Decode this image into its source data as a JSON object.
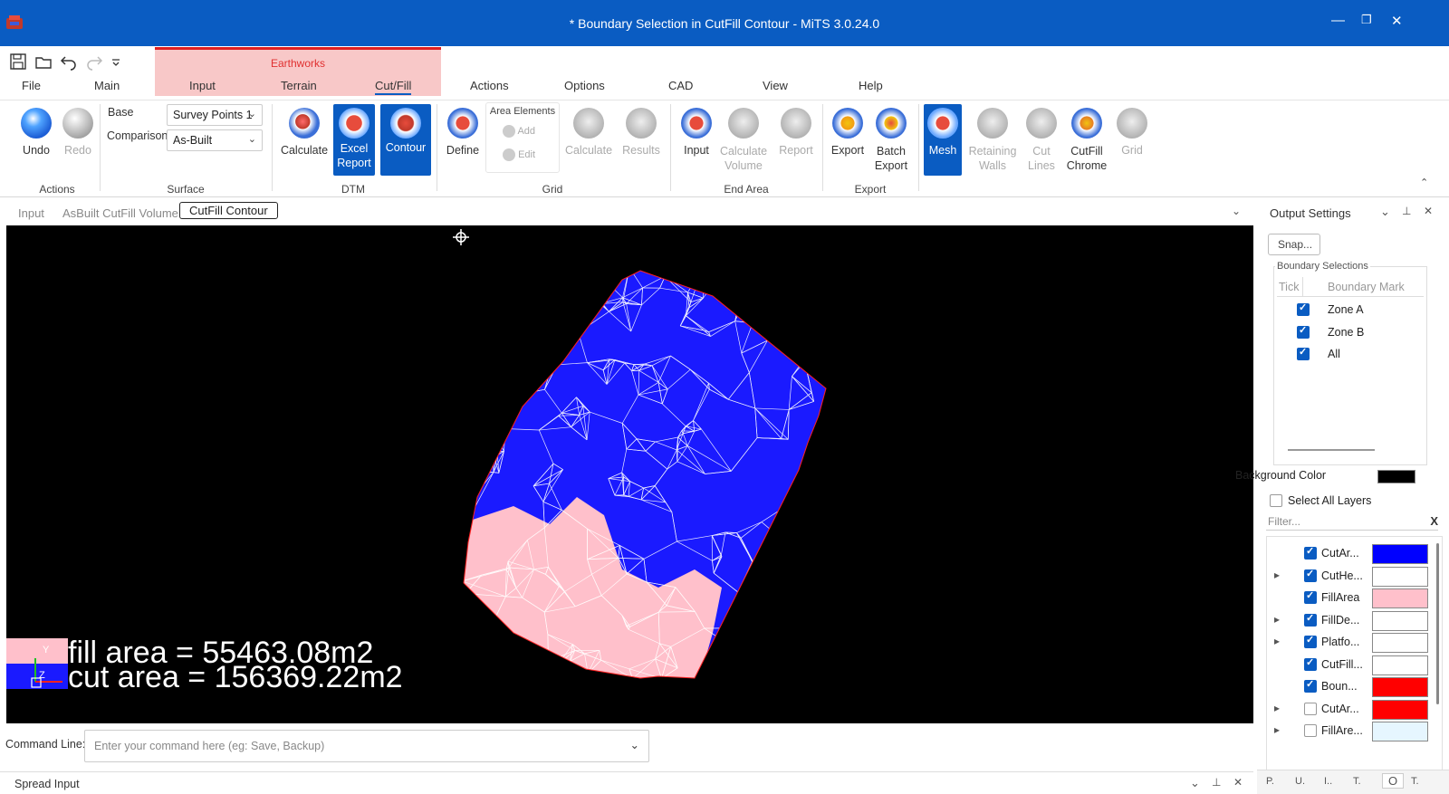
{
  "window": {
    "title": "* Boundary Selection in CutFill Contour - MiTS 3.0.24.0",
    "controls": [
      "—",
      "❐",
      "✕"
    ]
  },
  "ribbon_tabs": {
    "context_group": "Earthworks",
    "items": [
      "File",
      "Main",
      "Input",
      "Terrain",
      "Cut/Fill",
      "Actions",
      "Options",
      "CAD",
      "View",
      "Help"
    ],
    "active": "Cut/Fill"
  },
  "ribbon": {
    "actions": {
      "undo": "Undo",
      "redo": "Redo",
      "group": "Actions"
    },
    "surface": {
      "base_label": "Base",
      "base_value": "Survey Points 1",
      "comparison_label": "Comparison",
      "comparison_value": "As-Built",
      "group": "Surface"
    },
    "dtm": {
      "calculate": "Calculate",
      "excel_report": "Excel Report",
      "contour": "Contour",
      "group": "DTM"
    },
    "grid": {
      "define": "Define",
      "area_elements": "Area Elements",
      "add": "Add",
      "edit": "Edit",
      "calculate": "Calculate",
      "results": "Results",
      "group": "Grid"
    },
    "end_area": {
      "input": "Input",
      "calculate_volume": "Calculate Volume",
      "report": "Report",
      "group": "End Area"
    },
    "export": {
      "export": "Export",
      "batch_export": "Batch Export",
      "group": "Export"
    },
    "misc": {
      "mesh": "Mesh",
      "retaining_walls": "Retaining Walls",
      "cut_lines": "Cut Lines",
      "cutfill_chrome": "CutFill Chrome",
      "grid": "Grid"
    }
  },
  "doc_tabs": {
    "items": [
      "Input",
      "AsBuilt CutFill Volume",
      "CutFill Contour"
    ],
    "active": "CutFill Contour"
  },
  "viewport": {
    "fill_text": "fill area = 55463.08m2",
    "cut_text": "cut area = 156369.22m2",
    "axis_y": "Y",
    "axis_z": "Z",
    "colors": {
      "background": "#000000",
      "cut": "#1a1aff",
      "fill": "#ffc0cb",
      "mesh": "#ffffff"
    }
  },
  "command_line": {
    "label": "Command Line:",
    "placeholder": "Enter your command here (eg: Save, Backup)"
  },
  "spread_input": {
    "label": "Spread Input"
  },
  "output_settings": {
    "title": "Output Settings",
    "snap_button": "Snap...",
    "boundary_selections": {
      "title": "Boundary Selections",
      "headers": [
        "Tick",
        "Boundary Mark"
      ],
      "rows": [
        {
          "checked": true,
          "label": "Zone A"
        },
        {
          "checked": true,
          "label": "Zone B"
        },
        {
          "checked": true,
          "label": "All"
        }
      ]
    },
    "background_color_label": "Background Color",
    "background_color": "#000000",
    "select_all_layers": "Select All Layers",
    "filter_placeholder": "Filter...",
    "filter_clear": "X",
    "layers": [
      {
        "expand": false,
        "checked": true,
        "name": "CutAr...",
        "color": "#0000ff"
      },
      {
        "expand": true,
        "checked": true,
        "name": "CutHe...",
        "color": "#ffffff"
      },
      {
        "expand": false,
        "checked": true,
        "name": "FillArea",
        "color": "#ffc0cb"
      },
      {
        "expand": true,
        "checked": true,
        "name": "FillDe...",
        "color": "#ffffff"
      },
      {
        "expand": true,
        "checked": true,
        "name": "Platfo...",
        "color": "#ffffff"
      },
      {
        "expand": false,
        "checked": true,
        "name": "CutFill...",
        "color": "#ffffff"
      },
      {
        "expand": false,
        "checked": true,
        "name": "Boun...",
        "color": "#ff0000"
      },
      {
        "expand": true,
        "checked": false,
        "name": "CutAr...",
        "color": "#ff0000"
      },
      {
        "expand": true,
        "checked": false,
        "name": "FillAre...",
        "color": "#e6f6ff"
      }
    ],
    "bottom_tabs": [
      "P.",
      "U.",
      "I..",
      "T.",
      "O",
      "T."
    ]
  }
}
